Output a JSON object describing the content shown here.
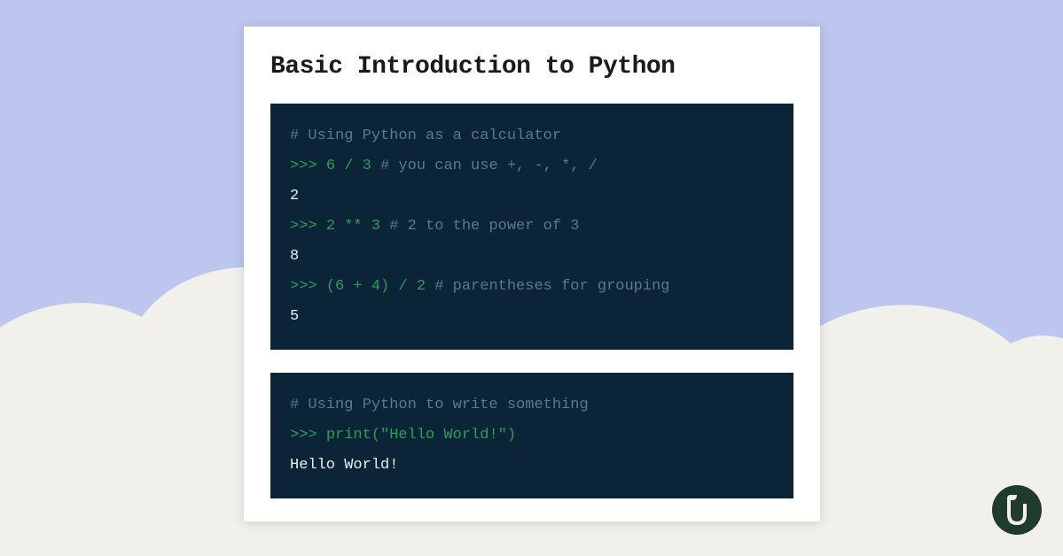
{
  "title": "Basic Introduction to Python",
  "blocks": [
    {
      "lines": [
        {
          "segments": [
            {
              "cls": "comment",
              "text": "# Using Python as a calculator"
            }
          ]
        },
        {
          "segments": [
            {
              "cls": "prompt",
              "text": ">>> "
            },
            {
              "cls": "code",
              "text": "6 / 3"
            },
            {
              "cls": "comment",
              "text": " # you can use +, -, *, /"
            }
          ]
        },
        {
          "segments": [
            {
              "cls": "output",
              "text": "2"
            }
          ]
        },
        {
          "segments": [
            {
              "cls": "prompt",
              "text": ">>> "
            },
            {
              "cls": "code",
              "text": "2 ** 3"
            },
            {
              "cls": "comment",
              "text": " # 2 to the power of 3"
            }
          ]
        },
        {
          "segments": [
            {
              "cls": "output",
              "text": "8"
            }
          ]
        },
        {
          "segments": [
            {
              "cls": "prompt",
              "text": ">>> "
            },
            {
              "cls": "code",
              "text": "(6 + 4) / 2"
            },
            {
              "cls": "comment",
              "text": " # parentheses for grouping"
            }
          ]
        },
        {
          "segments": [
            {
              "cls": "output",
              "text": "5"
            }
          ]
        }
      ]
    },
    {
      "lines": [
        {
          "segments": [
            {
              "cls": "comment",
              "text": "# Using Python to write something"
            }
          ]
        },
        {
          "segments": [
            {
              "cls": "prompt",
              "text": ">>> "
            },
            {
              "cls": "code",
              "text": "print(\"Hello World!\")"
            }
          ]
        },
        {
          "segments": [
            {
              "cls": "output",
              "text": "Hello World!"
            }
          ]
        }
      ]
    }
  ]
}
